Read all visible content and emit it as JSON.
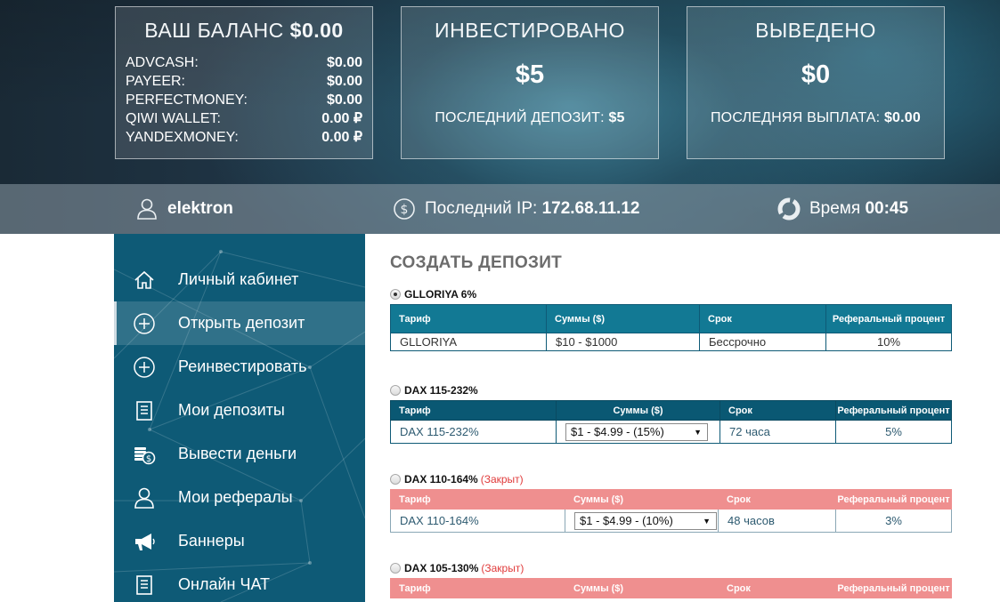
{
  "balance": {
    "title": "ВАШ БАЛАНС",
    "total": "$0.00",
    "rows": [
      {
        "name": "ADVCASH:",
        "value": "$0.00"
      },
      {
        "name": "PAYEER:",
        "value": "$0.00"
      },
      {
        "name": "PERFECTMONEY:",
        "value": "$0.00"
      },
      {
        "name": "QIWI WALLET:",
        "value": "0.00 ₽"
      },
      {
        "name": "YANDEXMONEY:",
        "value": "0.00 ₽"
      }
    ]
  },
  "invested": {
    "title": "ИНВЕСТИРОВАНО",
    "amount": "$5",
    "sub_label": "ПОСЛЕДНИЙ ДЕПОЗИТ:",
    "sub_value": "$5"
  },
  "withdrawn": {
    "title": "ВЫВЕДЕНО",
    "amount": "$0",
    "sub_label": "ПОСЛЕДНЯЯ ВЫПЛАТА:",
    "sub_value": "$0.00"
  },
  "info": {
    "username": "elektron",
    "ip_label": "Последний IP:",
    "ip_value": "172.68.11.12",
    "time_label": "Время",
    "time_value": "00:45"
  },
  "sidebar": {
    "items": [
      {
        "label": "Личный кабинет",
        "icon": "home-icon"
      },
      {
        "label": "Открыть депозит",
        "icon": "plus-circle-icon"
      },
      {
        "label": "Реинвестировать",
        "icon": "plus-circle-icon"
      },
      {
        "label": "Мои депозиты",
        "icon": "document-icon"
      },
      {
        "label": "Вывести деньги",
        "icon": "coins-icon"
      },
      {
        "label": "Мои рефералы",
        "icon": "user-icon"
      },
      {
        "label": "Баннеры",
        "icon": "megaphone-icon"
      },
      {
        "label": "Онлайн ЧАТ",
        "icon": "document-icon"
      }
    ],
    "active_index": 1
  },
  "main": {
    "title": "СОЗДАТЬ ДЕПОЗИТ",
    "headers": {
      "tariff": "Тариф",
      "sums": "Суммы ($)",
      "term": "Срок",
      "ref": "Реферальный процент"
    },
    "plans": [
      {
        "name": "GLLORIYA 6%",
        "selected": true,
        "closed": "",
        "tariff": "GLLORIYA",
        "sums": "$10 - $1000",
        "term": "Бессрочно",
        "ref": "10%"
      },
      {
        "name": "DAX 115-232%",
        "selected": false,
        "closed": "",
        "tariff": "DAX 115-232%",
        "sums": "$1 - $4.99 - (15%)",
        "term": "72 часа",
        "ref": "5%"
      },
      {
        "name": "DAX 110-164%",
        "selected": false,
        "closed": "(Закрыт)",
        "tariff": "DAX 110-164%",
        "sums": "$1 - $4.99 - (10%)",
        "term": "48 часов",
        "ref": "3%"
      },
      {
        "name": "DAX 105-130%",
        "selected": false,
        "closed": "(Закрыт)"
      }
    ]
  },
  "colors": {
    "sidebar": "#0e5a76",
    "table_header": "#0e6a86",
    "closed_header": "#ef8f8f",
    "closed_text": "#e03a3a"
  }
}
